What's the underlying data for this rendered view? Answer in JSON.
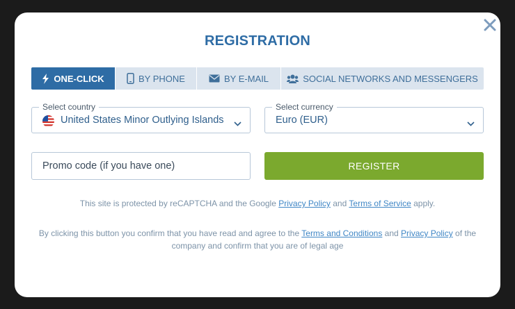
{
  "modal": {
    "title": "REGISTRATION",
    "close_icon": "close-icon"
  },
  "tabs": [
    {
      "label": "ONE-CLICK",
      "icon": "lightning-icon",
      "active": true
    },
    {
      "label": "BY PHONE",
      "icon": "phone-icon",
      "active": false
    },
    {
      "label": "BY E-MAIL",
      "icon": "envelope-icon",
      "active": false
    },
    {
      "label": "SOCIAL NETWORKS AND MESSENGERS",
      "icon": "users-icon",
      "active": false
    }
  ],
  "country": {
    "legend": "Select country",
    "value": "United States Minor Outlying Islands",
    "flag_icon": "us-flag-icon"
  },
  "currency": {
    "legend": "Select currency",
    "value": "Euro (EUR)"
  },
  "promo": {
    "placeholder": "Promo code (if you have one)",
    "value": ""
  },
  "register_label": "REGISTER",
  "recaptcha": {
    "prefix": "This site is protected by reCAPTCHA and the Google ",
    "privacy_link": "Privacy Policy",
    "and": " and ",
    "terms_link": "Terms of Service",
    "suffix": " apply."
  },
  "consent": {
    "prefix": "By clicking this button you confirm that you have read and agree to the ",
    "terms_link": "Terms and Conditions",
    "and": " and ",
    "privacy_link": "Privacy Policy",
    "suffix": " of the company and confirm that you are of legal age"
  },
  "colors": {
    "accent": "#2e6ca5",
    "tab_bg": "#dbe4ee",
    "register": "#7ba92e",
    "link": "#3f86c5",
    "backdrop": "#1b1b1b"
  }
}
